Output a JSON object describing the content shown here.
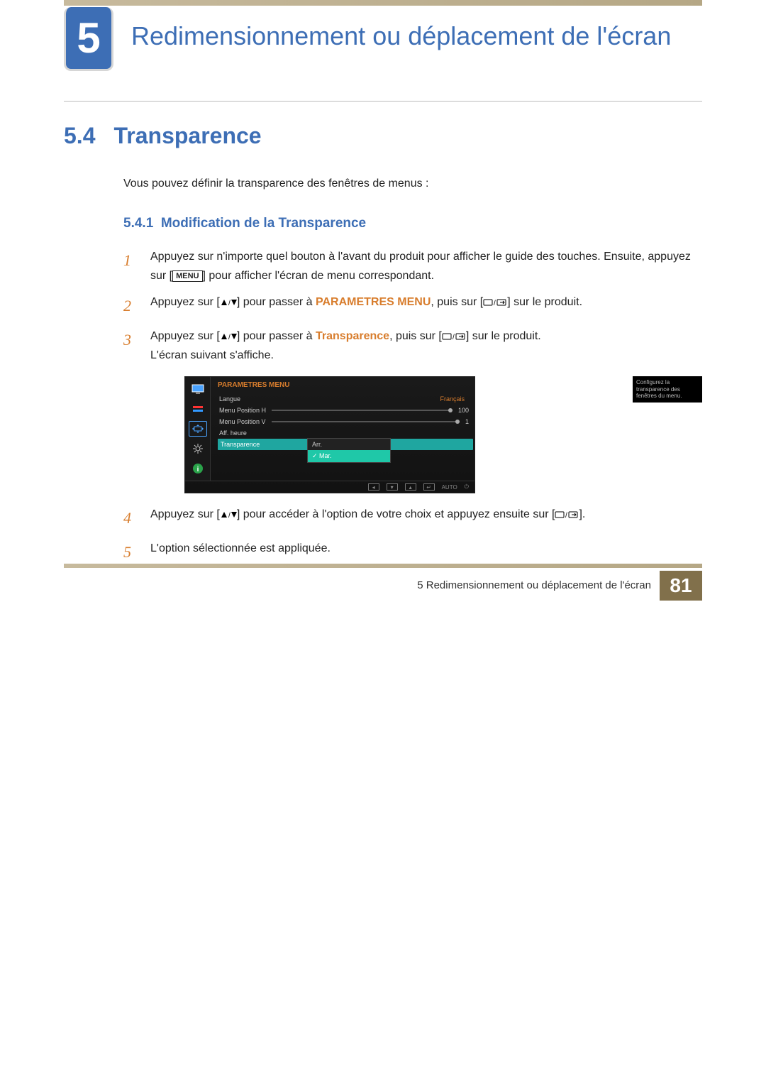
{
  "chapter": {
    "number": "5",
    "title": "Redimensionnement ou déplacement de l'écran"
  },
  "section": {
    "number": "5.4",
    "title": "Transparence",
    "intro": "Vous pouvez définir la transparence des fenêtres de menus :"
  },
  "subsection": {
    "number": "5.4.1",
    "title": "Modification de la Transparence"
  },
  "steps": {
    "menu_key": "MENU",
    "s1a": "Appuyez sur n'importe quel bouton à l'avant du produit pour afficher le guide des touches. Ensuite, appuyez sur [",
    "s1b": "] pour afficher l'écran de menu correspondant.",
    "s2a": "Appuyez sur [",
    "s2b": "] pour passer à ",
    "s2_highlight": "PARAMETRES MENU",
    "s2c": ", puis sur [",
    "s2d": "] sur le produit.",
    "s3a": "Appuyez sur [",
    "s3b": "] pour passer à ",
    "s3_highlight": "Transparence",
    "s3c": ", puis sur [",
    "s3d": "] sur le produit.",
    "s3e": "L'écran suivant s'affiche.",
    "s4a": "Appuyez sur [",
    "s4b": "] pour accéder à l'option de votre choix et appuyez ensuite sur [",
    "s4c": "].",
    "s5": "L'option sélectionnée est appliquée."
  },
  "osd": {
    "title": "PARAMETRES MENU",
    "help": "Configurez la transparence des fenêtres du menu.",
    "rows": {
      "langue_label": "Langue",
      "langue_value": "Français",
      "posh_label": "Menu Position H",
      "posh_value": "100",
      "posv_label": "Menu Position V",
      "posv_value": "1",
      "aff_label": "Aff. heure",
      "trans_label": "Transparence"
    },
    "dropdown": {
      "opt1": "Arr.",
      "opt2": "Mar."
    },
    "bottom": {
      "auto": "AUTO"
    }
  },
  "footer": {
    "text": "5 Redimensionnement ou déplacement de l'écran",
    "page": "81"
  }
}
